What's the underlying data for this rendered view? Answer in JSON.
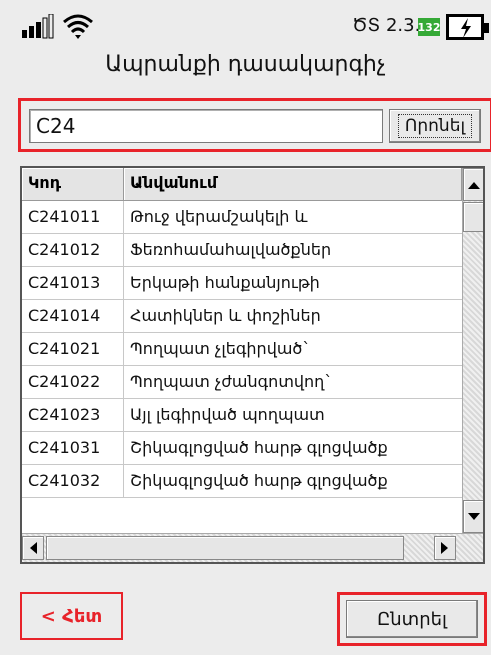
{
  "status": {
    "version": "ԾՏ 2.3.8",
    "battery_badge": "132",
    "icons": [
      "signal-bars-icon",
      "wifi-icon",
      "battery-charging-icon"
    ]
  },
  "title": "Ապրանքի դասակարգիչ",
  "search": {
    "value": "C24",
    "button_label": "Որոնել"
  },
  "table": {
    "columns": [
      "Կոդ",
      "Անվանում"
    ],
    "rows": [
      {
        "code": "C241011",
        "name": "Թուջ վերամշակելի և"
      },
      {
        "code": "C241012",
        "name": "Ֆեռոհամահալվածքներ"
      },
      {
        "code": "C241013",
        "name": "Երկաթի հանքանյութի"
      },
      {
        "code": "C241014",
        "name": "Հատիկներ և փոշիներ"
      },
      {
        "code": "C241021",
        "name": "Պողպատ չլեգիրված`"
      },
      {
        "code": "C241022",
        "name": "Պողպատ չժանգոտվող`"
      },
      {
        "code": "C241023",
        "name": "Այլ լեգիրված պողպատ"
      },
      {
        "code": "C241031",
        "name": "Շիկագլոցված հարթ գլոցվածք"
      },
      {
        "code": "C241032",
        "name": "Շիկագլոցված հարթ գլոցվածք"
      }
    ]
  },
  "footer": {
    "back_label": "< Հետ",
    "select_label": "Ընտրել"
  },
  "colors": {
    "accent_red": "#e8232a",
    "battery_green": "#35a936"
  }
}
